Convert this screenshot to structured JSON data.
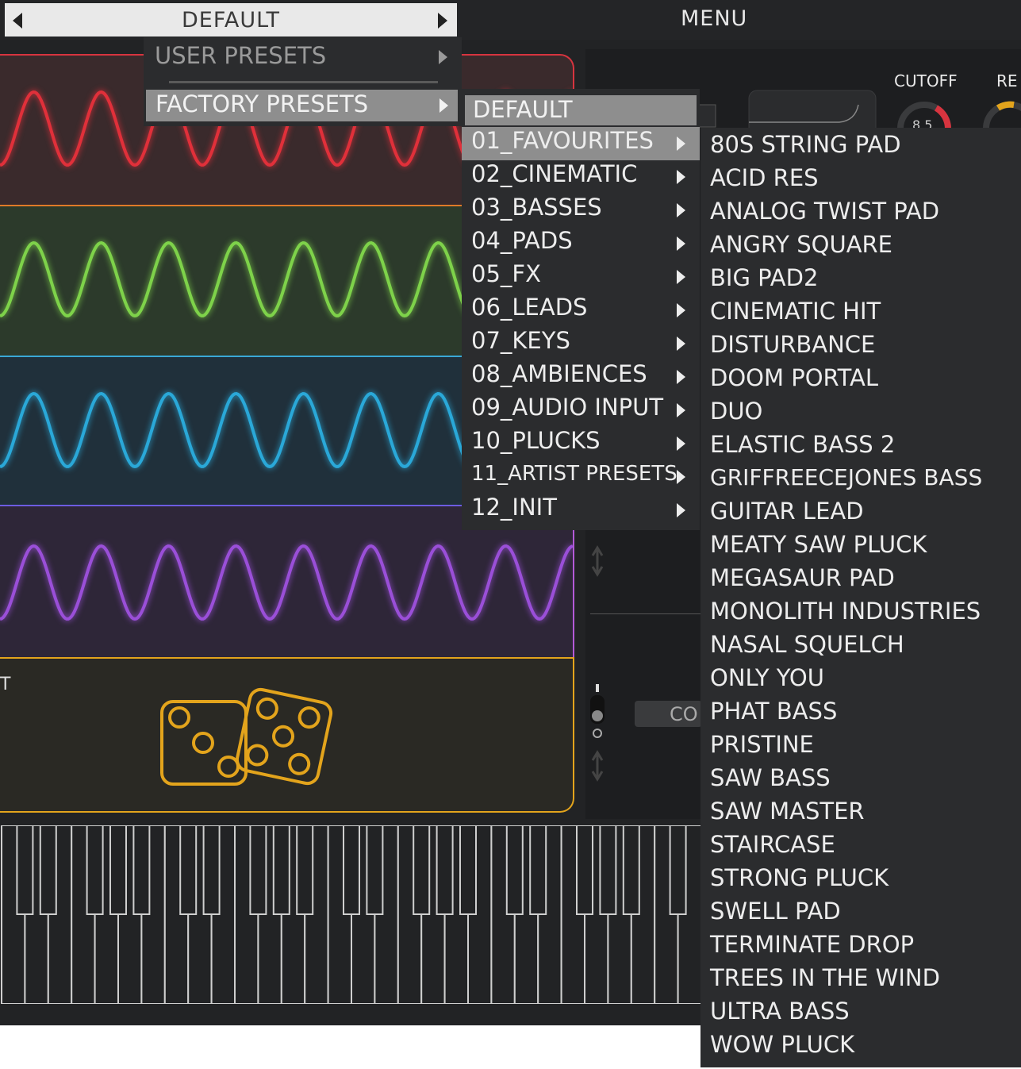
{
  "preset_bar": {
    "current": "DEFAULT"
  },
  "menu_button": "MENU",
  "knobs": [
    {
      "label": "CUTOFF",
      "value": "8.5"
    },
    {
      "label": "RE"
    }
  ],
  "osc5": {
    "label": "T"
  },
  "co_button": "CO",
  "colors": {
    "osc1": "#e0303a",
    "osc2": "#7ed24a",
    "osc3": "#2aa8d8",
    "osc4": "#9a4fd8",
    "random": "#e3a41c"
  },
  "menu_level1": {
    "user_presets": "USER PRESETS",
    "factory_presets": "FACTORY PRESETS"
  },
  "menu_level2": {
    "default": "DEFAULT",
    "items": [
      "01_FAVOURITES",
      "02_CINEMATIC",
      "03_BASSES",
      "04_PADS",
      "05_FX",
      "06_LEADS",
      "07_KEYS",
      "08_AMBIENCES",
      "09_AUDIO INPUT",
      "10_PLUCKS",
      "11_ARTIST PRESETS",
      "12_INIT"
    ]
  },
  "menu_level3": {
    "items": [
      "80S STRING PAD",
      "ACID RES",
      "ANALOG TWIST PAD",
      "ANGRY SQUARE",
      "BIG PAD2",
      "CINEMATIC HIT",
      "DISTURBANCE",
      "DOOM PORTAL",
      "DUO",
      "ELASTIC BASS 2",
      "GRIFFREECEJONES BASS",
      "GUITAR LEAD",
      "MEATY SAW PLUCK",
      "MEGASAUR PAD",
      "MONOLITH INDUSTRIES",
      "NASAL SQUELCH",
      "ONLY YOU",
      "PHAT BASS",
      "PRISTINE",
      "SAW BASS",
      "SAW MASTER",
      "STAIRCASE",
      "STRONG PLUCK",
      "SWELL PAD",
      "TERMINATE DROP",
      "TREES IN THE WIND",
      "ULTRA BASS",
      "WOW PLUCK"
    ]
  }
}
